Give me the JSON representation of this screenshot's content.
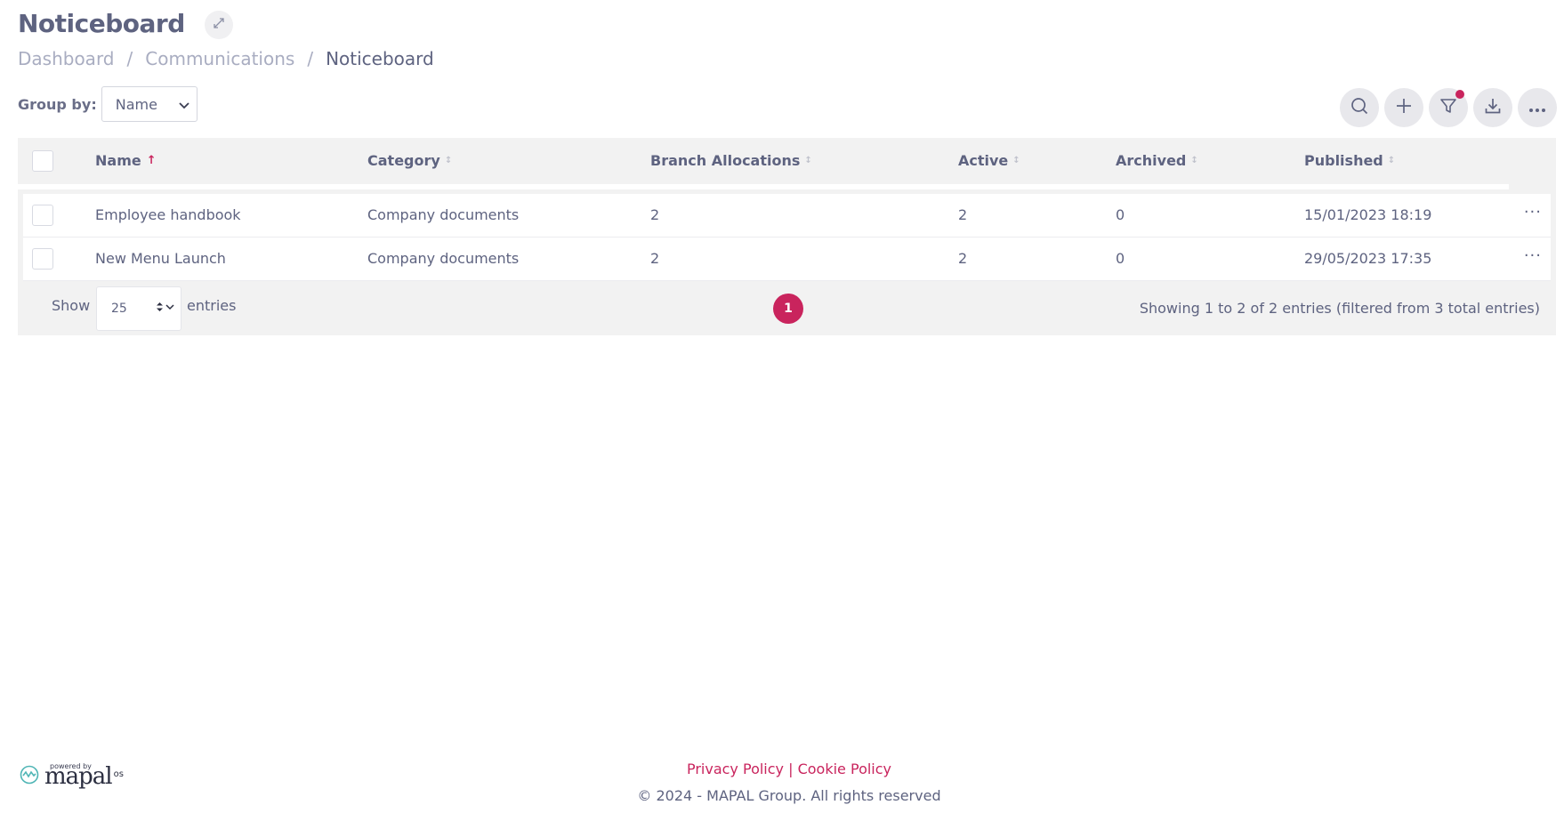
{
  "header": {
    "title": "Noticeboard",
    "breadcrumb": [
      "Dashboard",
      "Communications",
      "Noticeboard"
    ],
    "separator": "/"
  },
  "group_by": {
    "label": "Group by:",
    "selected": "Name"
  },
  "toolbar": {
    "icons": [
      "search-icon",
      "plus-icon",
      "filter-icon",
      "download-icon",
      "more-icon"
    ],
    "filter_active_color": "#c9245d"
  },
  "table": {
    "columns": [
      {
        "label": "Name",
        "sort": "asc"
      },
      {
        "label": "Category",
        "sort": "none"
      },
      {
        "label": "Branch Allocations",
        "sort": "none"
      },
      {
        "label": "Active",
        "sort": "none"
      },
      {
        "label": "Archived",
        "sort": "none"
      },
      {
        "label": "Published",
        "sort": "none"
      }
    ],
    "rows": [
      {
        "name": "Employee handbook",
        "category": "Company documents",
        "branch_allocations": "2",
        "active": "2",
        "archived": "0",
        "published": "15/01/2023 18:19"
      },
      {
        "name": "New Menu Launch",
        "category": "Company documents",
        "branch_allocations": "2",
        "active": "2",
        "archived": "0",
        "published": "29/05/2023 17:35"
      }
    ],
    "row_action": "···"
  },
  "pagination": {
    "show_label": "Show",
    "page_length": "25",
    "entries_label": "entries",
    "current_page": "1",
    "info": "Showing 1 to 2 of 2 entries (filtered from 3 total entries)"
  },
  "footer": {
    "privacy": "Privacy Policy",
    "link_separator": "|",
    "cookie": "Cookie Policy",
    "copyright": "© 2024 - MAPAL Group. All rights reserved"
  },
  "brand": {
    "powered_by": "powered by",
    "name": "mapal",
    "suffix": "os"
  },
  "colors": {
    "accent": "#c9245d",
    "text": "#5e6380",
    "muted": "#a9adc1",
    "table_bg": "#f2f2f2"
  }
}
